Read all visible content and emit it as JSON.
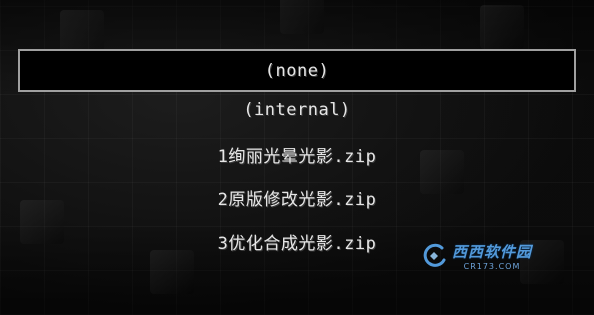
{
  "shader_list": {
    "items": [
      {
        "label": "(none)",
        "selected": true
      },
      {
        "label": "(internal)",
        "selected": false
      },
      {
        "label": "1绚丽光晕光影.zip",
        "selected": false
      },
      {
        "label": "2原版修改光影.zip",
        "selected": false
      },
      {
        "label": "3优化合成光影.zip",
        "selected": false
      }
    ]
  },
  "watermark": {
    "main": "西西软件园",
    "sub": "CR173.COM"
  }
}
